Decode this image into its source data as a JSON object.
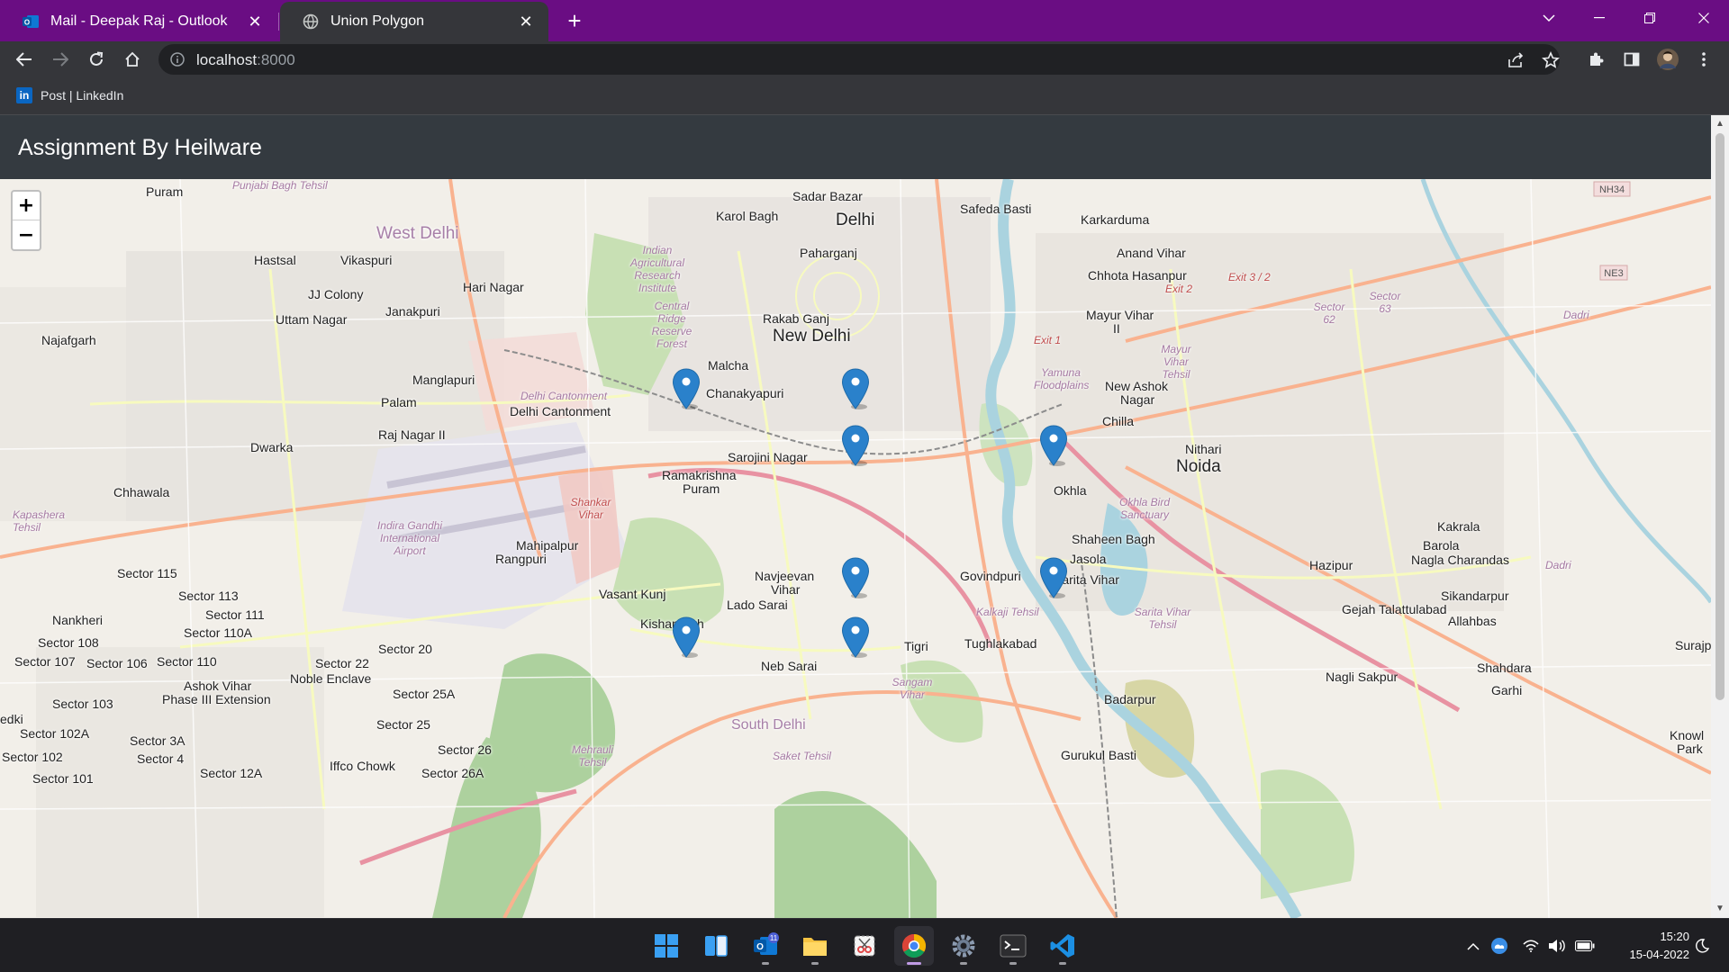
{
  "browser": {
    "tabs": [
      {
        "title": "Mail - Deepak Raj - Outlook",
        "icon": "outlook-icon",
        "active": false
      },
      {
        "title": "Union Polygon",
        "icon": "globe-icon",
        "active": true
      }
    ],
    "address": {
      "host": "localhost",
      "port": ":8000"
    },
    "bookmark": {
      "label": "Post | LinkedIn",
      "logo": "in"
    },
    "colors": {
      "tabstrip": "#6a0d83",
      "toolbar": "#35363a"
    }
  },
  "app": {
    "title": "Assignment By Heilware",
    "header_color": "#343a40"
  },
  "map": {
    "zoom_in": "+",
    "zoom_out": "−",
    "marker_color": "#2a81cb",
    "marker_count": 8,
    "places": {
      "delhi": "Delhi",
      "new_delhi": "New Delhi",
      "noida": "Noida",
      "south_delhi": "South Delhi",
      "west_delhi": "West Delhi",
      "delhi_cantonment": "Delhi Cantonment",
      "najafgarh": "Najafgarh",
      "dwarka": "Dwarka",
      "sadar_bazar": "Sadar Bazar",
      "karol_bagh": "Karol Bagh",
      "paharganj": "Paharganj",
      "safeda_basti": "Safeda Basti",
      "karkarduma": "Karkarduma",
      "anand_vihar": "Anand Vihar",
      "hastsal": "Hastsal",
      "vikaspuri": "Vikaspuri",
      "hari_nagar": "Hari Nagar",
      "jj_colony": "JJ Colony",
      "uttam_nagar": "Uttam Nagar",
      "janakpuri": "Janakpuri",
      "rakab_ganj": "Rakab Ganj",
      "malcha": "Malcha",
      "chanakyapuri": "Chanakyapuri",
      "sarojini_nagar": "Sarojini Nagar",
      "rk_puram_1": "Ramakrishna",
      "rk_puram_2": "Puram",
      "manglapuri": "Manglapuri",
      "palam": "Palam",
      "raj_nagar": "Raj Nagar II",
      "chhawala": "Chhawala",
      "mahipalpur": "Mahipalpur",
      "rangpuri": "Rangpuri",
      "vasant_kunj": "Vasant Kunj",
      "navjeevan_1": "Navjeevan",
      "navjeevan_2": "Vihar",
      "lado_sarai": "Lado Sarai",
      "kishangarh": "Kishangarh",
      "neb_sarai": "Neb Sarai",
      "tigri": "Tigri",
      "tughlakabad": "Tughlakabad",
      "govindpuri": "Govindpuri",
      "sarita_vihar": "Sarita Vihar",
      "jasola": "Jasola",
      "shaheen_bagh": "Shaheen Bagh",
      "okhla": "Okhla",
      "chilla": "Chilla",
      "new_ashok_1": "New Ashok",
      "new_ashok_2": "Nagar",
      "mayur_vihar_1": "Mayur Vihar",
      "mayur_vihar_2": "II",
      "chhota_hasanpur": "Chhota Hasanpur",
      "nithari": "Nithari",
      "kakrala": "Kakrala",
      "barola": "Barola",
      "nagla_charandas": "Nagla Charandas",
      "hazipur": "Hazipur",
      "sikandarpur": "Sikandarpur",
      "gejah": "Gejah Talattulabad",
      "allahbas": "Allahbas",
      "surajpur": "Surajp",
      "shahdara": "Shahdara",
      "garhi": "Garhi",
      "nagli_sakpur": "Nagli Sakpur",
      "badarpur": "Badarpur",
      "gurukul_basti": "Gurukul Basti",
      "knowl_1": "Knowl",
      "knowl_2": "Park",
      "sector_115": "Sector 115",
      "sector_113": "Sector 113",
      "sector_111": "Sector 111",
      "sector_110a": "Sector 110A",
      "sector_110": "Sector 110",
      "sector_108": "Sector 108",
      "sector_107": "Sector 107",
      "sector_106": "Sector 106",
      "sector_103": "Sector 103",
      "sector_102a": "Sector 102A",
      "sector_102": "Sector 102",
      "sector_101": "Sector 101",
      "sector_3a": "Sector 3A",
      "sector_4": "Sector 4",
      "sector_12a": "Sector 12A",
      "sector_20": "Sector 20",
      "sector_22": "Sector 22",
      "sector_25a": "Sector 25A",
      "sector_25": "Sector 25",
      "sector_26": "Sector 26",
      "sector_26a": "Sector 26A",
      "nankheri": "Nankheri",
      "ashok_vihar_1": "Ashok Vihar",
      "ashok_vihar_2": "Phase III Extension",
      "noble_enclave": "Noble Enclave",
      "iffco_chowk": "Iffco Chowk",
      "edki": "edki",
      "puram_top": "Puram"
    },
    "districts": {
      "kapashera": "Kapashera Tehsil",
      "delhi_cantt": "Delhi Cantonment",
      "shankar_vihar": "Shankar Vihar",
      "igi_airport": "Indira Gandhi International Airport",
      "iari": "Indian Agricultural Research Institute",
      "central_ridge": "Central Ridge Reserve Forest",
      "kalkaji": "Kalkaji Tehsil",
      "sangam_vihar": "Sangam Vihar",
      "mehrauli": "Mehrauli Tehsil",
      "saket": "Saket Tehsil",
      "sarita_vihar_tehsil": "Sarita Vihar Tehsil",
      "yamuna": "Yamuna Floodplains",
      "okhla_bird": "Okhla Bird Sanctuary",
      "mayur_vihar_tehsil": "Mayur Vihar Tehsil",
      "sector_62": "Sector 62",
      "sector_63": "Sector 63",
      "dadri": "Dadri",
      "punjabi_bagh": "Punjabi Bagh Tehsil"
    },
    "roads": {
      "nh34": "NH34",
      "ne3": "NE3",
      "exit_1": "Exit 1",
      "exit_2": "Exit 2",
      "exit_3": "Exit 3 / 2"
    }
  },
  "taskbar": {
    "time": "15:20",
    "date": "15-04-2022",
    "badge": "11"
  }
}
